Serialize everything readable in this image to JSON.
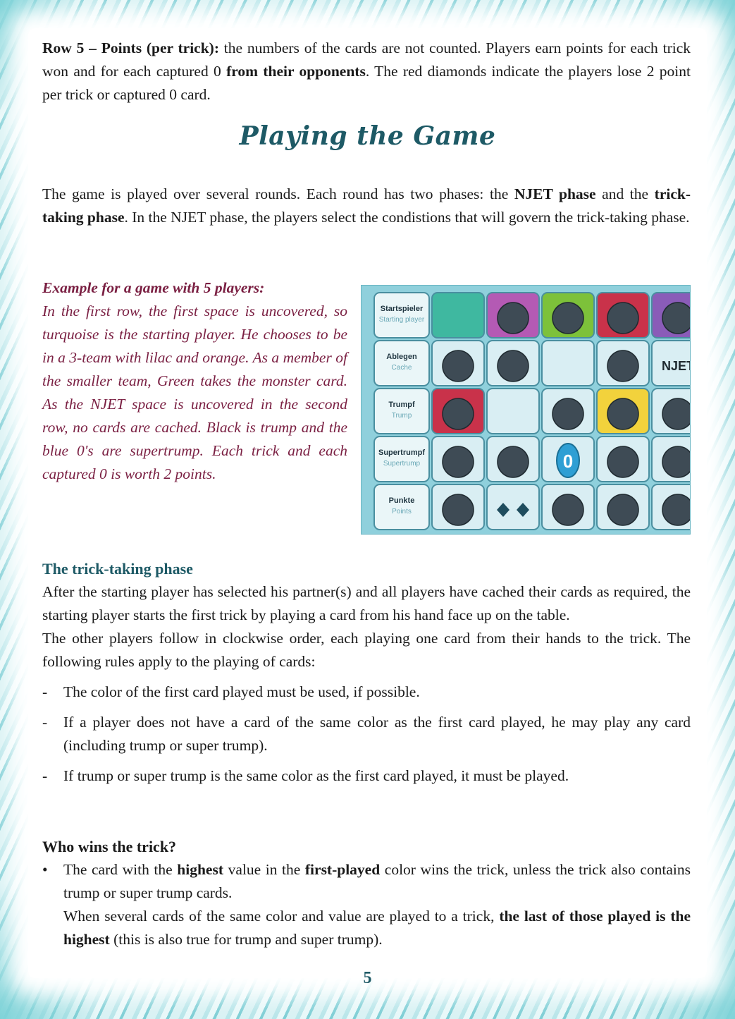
{
  "row5": {
    "label": "Row 5 – Points (per trick):",
    "text1": " the numbers of the cards are not counted. Players earn points for each trick won and for each captured 0 ",
    "bold2": "from their opponents",
    "text2": ". The red diamonds indicate the players lose 2 point per trick or captured 0 card."
  },
  "heading": "Playing the Game",
  "intro": {
    "t1": "The game is played over several rounds. Each round has two phases: the ",
    "b1": "NJET phase",
    "t2": " and the ",
    "b2": "trick-taking phase",
    "t3": ". In the NJET phase, the players select the condistions that will govern the trick-taking phase."
  },
  "example": {
    "title": "Example for a game with 5 players:",
    "body": "In the first row, the first space is uncovered, so turquoise is the starting player. He chooses to be in a 3-team with lilac and orange. As a member of the smaller team, Green takes the monster card. As the NJET space is uncovered in the second row, no cards are cached. Black is trump and the blue 0's are supertrump. Each trick and each captured 0 is worth 2 points."
  },
  "board": {
    "rows": [
      {
        "de": "Startspieler",
        "en": "Starting player"
      },
      {
        "de": "Ablegen",
        "en": "Cache"
      },
      {
        "de": "Trumpf",
        "en": "Trump"
      },
      {
        "de": "Supertrumpf",
        "en": "Supertrump"
      },
      {
        "de": "Punkte",
        "en": "Points"
      }
    ],
    "njet_label": "NJET",
    "zero_label": "0",
    "colors": {
      "turquoise": "#3fb8a0",
      "lilac": "#b45ab4",
      "green": "#7dc13a",
      "red": "#c9324a",
      "purple": "#8a5cb8",
      "yellow": "#f2d23c",
      "token": "#3e4b55",
      "tile": "#d9eef3"
    }
  },
  "trick_phase": {
    "title": "The trick-taking phase",
    "p1": "After the starting player has selected his partner(s) and all players have cached their cards as required, the starting player starts the first trick by playing a card from his hand face up on the table.",
    "p2": "The other players follow in clockwise order, each playing one card from their hands to the trick. The following rules apply to the playing of cards:",
    "rules": [
      "The color of the first card played must be used, if possible.",
      "If a player does not have a card of the same color as the first card played, he may play any card (including trump or super trump).",
      "If trump or super trump is the same color as the first card played, it must be played."
    ],
    "dash": "-"
  },
  "who_wins": {
    "title": "Who wins the trick?",
    "bullet": "•",
    "t1": "The card with the ",
    "b1": "highest",
    "t2": " value in the ",
    "b2": "first-played",
    "t3": " color wins the trick, unless the trick also contains trump or super trump cards.",
    "t4": "When several cards of the same color and value are played to a trick, ",
    "b3": "the last of those played is the highest",
    "t5": " (this is also true for trump and super trump)."
  },
  "page_number": "5"
}
